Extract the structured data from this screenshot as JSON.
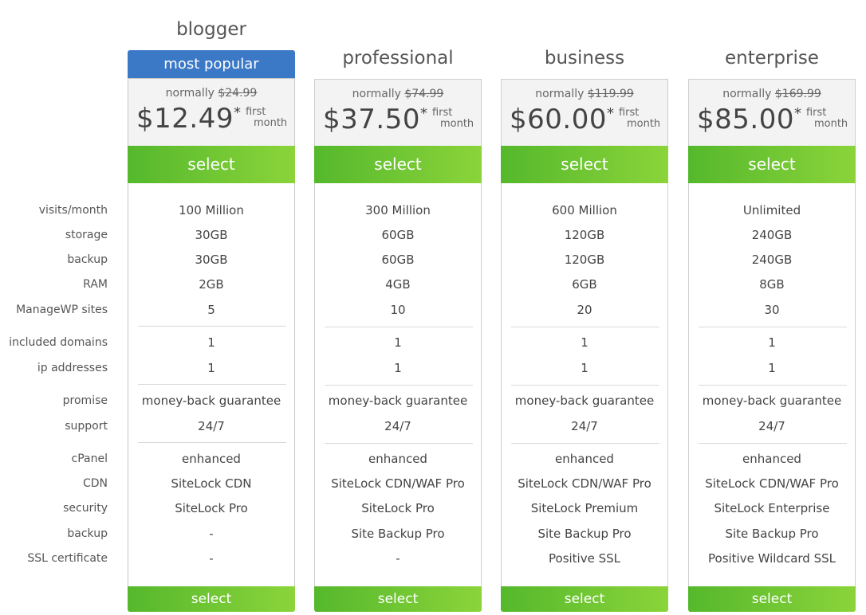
{
  "labels": {
    "visits": "visits/month",
    "storage": "storage",
    "backup": "backup",
    "ram": "RAM",
    "managewp": "ManageWP sites",
    "domains": "included domains",
    "ip": "ip addresses",
    "promise": "promise",
    "support": "support",
    "cpanel": "cPanel",
    "cdn": "CDN",
    "security": "security",
    "backup2": "backup",
    "ssl": "SSL certificate"
  },
  "plans": [
    {
      "title": "blogger",
      "badge": "most popular",
      "normally": "normally",
      "old_price": "$24.99",
      "price": "$12.49",
      "star": "*",
      "first": "first",
      "month": "month",
      "select": "select",
      "visits": "100 Million",
      "storage": "30GB",
      "backup": "30GB",
      "ram": "2GB",
      "managewp": "5",
      "domains": "1",
      "ip": "1",
      "promise": "money-back guarantee",
      "support": "24/7",
      "cpanel": "enhanced",
      "cdn": "SiteLock CDN",
      "security": "SiteLock Pro",
      "backup2": "-",
      "ssl": "-"
    },
    {
      "title": "professional",
      "normally": "normally",
      "old_price": "$74.99",
      "price": "$37.50",
      "star": "*",
      "first": "first",
      "month": "month",
      "select": "select",
      "visits": "300 Million",
      "storage": "60GB",
      "backup": "60GB",
      "ram": "4GB",
      "managewp": "10",
      "domains": "1",
      "ip": "1",
      "promise": "money-back guarantee",
      "support": "24/7",
      "cpanel": "enhanced",
      "cdn": "SiteLock CDN/WAF Pro",
      "security": "SiteLock Pro",
      "backup2": "Site Backup Pro",
      "ssl": "-"
    },
    {
      "title": "business",
      "normally": "normally",
      "old_price": "$119.99",
      "price": "$60.00",
      "star": "*",
      "first": "first",
      "month": "month",
      "select": "select",
      "visits": "600 Million",
      "storage": "120GB",
      "backup": "120GB",
      "ram": "6GB",
      "managewp": "20",
      "domains": "1",
      "ip": "1",
      "promise": "money-back guarantee",
      "support": "24/7",
      "cpanel": "enhanced",
      "cdn": "SiteLock CDN/WAF Pro",
      "security": "SiteLock Premium",
      "backup2": "Site Backup Pro",
      "ssl": "Positive SSL"
    },
    {
      "title": "enterprise",
      "normally": "normally",
      "old_price": "$169.99",
      "price": "$85.00",
      "star": "*",
      "first": "first",
      "month": "month",
      "select": "select",
      "visits": "Unlimited",
      "storage": "240GB",
      "backup": "240GB",
      "ram": "8GB",
      "managewp": "30",
      "domains": "1",
      "ip": "1",
      "promise": "money-back guarantee",
      "support": "24/7",
      "cpanel": "enhanced",
      "cdn": "SiteLock CDN/WAF Pro",
      "security": "SiteLock Enterprise",
      "backup2": "Site Backup Pro",
      "ssl": "Positive Wildcard SSL"
    }
  ],
  "colors": {
    "badge": "#3b79c7",
    "select_start": "#55b82c",
    "select_end": "#8bd43a"
  }
}
